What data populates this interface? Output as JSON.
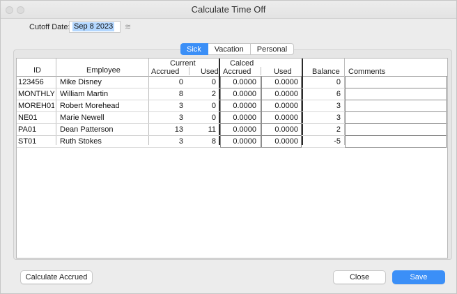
{
  "window": {
    "title": "Calculate Time Off"
  },
  "cutoff": {
    "label": "Cutoff Date:",
    "value": "Sep 8 2023"
  },
  "tabs": [
    {
      "label": "Sick",
      "active": true
    },
    {
      "label": "Vacation",
      "active": false
    },
    {
      "label": "Personal",
      "active": false
    }
  ],
  "table": {
    "headers": {
      "id": "ID",
      "employee": "Employee",
      "current": "Current",
      "current_accrued": "Accrued",
      "current_used": "Used",
      "calced": "Calced",
      "calced_accrued": "Accrued",
      "calced_used": "Used",
      "balance": "Balance",
      "comments": "Comments"
    },
    "rows": [
      {
        "id": "123456",
        "employee": "Mike Disney",
        "accrued": "0",
        "used": "0",
        "calced_accrued": "0.0000",
        "calced_used": "0.0000",
        "balance": "0",
        "comments": ""
      },
      {
        "id": "MONTHLY-M",
        "employee": "William Martin",
        "accrued": "8",
        "used": "2",
        "calced_accrued": "0.0000",
        "calced_used": "0.0000",
        "balance": "6",
        "comments": ""
      },
      {
        "id": "MOREH01",
        "employee": "Robert Morehead",
        "accrued": "3",
        "used": "0",
        "calced_accrued": "0.0000",
        "calced_used": "0.0000",
        "balance": "3",
        "comments": ""
      },
      {
        "id": "NE01",
        "employee": "Marie Newell",
        "accrued": "3",
        "used": "0",
        "calced_accrued": "0.0000",
        "calced_used": "0.0000",
        "balance": "3",
        "comments": ""
      },
      {
        "id": "PA01",
        "employee": "Dean Patterson",
        "accrued": "13",
        "used": "11",
        "calced_accrued": "0.0000",
        "calced_used": "0.0000",
        "balance": "2",
        "comments": ""
      },
      {
        "id": "ST01",
        "employee": "Ruth Stokes",
        "accrued": "3",
        "used": "8",
        "calced_accrued": "0.0000",
        "calced_used": "0.0000",
        "balance": "-5",
        "comments": ""
      }
    ]
  },
  "buttons": {
    "calculate": "Calculate Accrued",
    "close": "Close",
    "save": "Save"
  },
  "colors": {
    "accent": "#3b8ff7",
    "selection": "#b3d7ff"
  }
}
